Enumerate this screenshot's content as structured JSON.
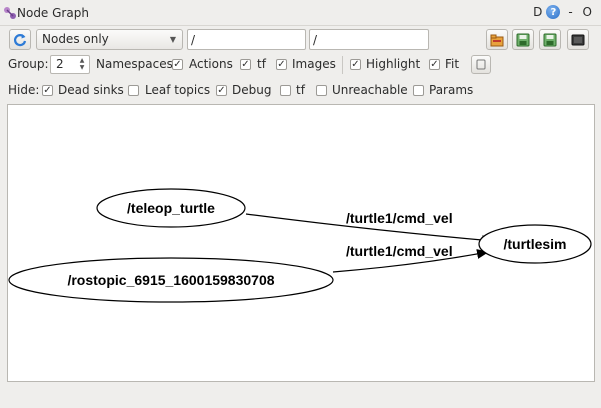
{
  "window": {
    "title": "Node Graph",
    "right_label": "D",
    "help_glyph": "?",
    "controls": "- O"
  },
  "toolbar": {
    "graph_mode": "Nodes only",
    "graph_mode_options": [
      "Nodes only"
    ],
    "filter_nodes": "/",
    "filter_topics": "/",
    "icons": [
      "refresh-icon",
      "load-dot-icon",
      "save-dot-icon",
      "save-svg-icon",
      "save-image-icon"
    ]
  },
  "options": {
    "group_label": "Group:",
    "group_value": "2",
    "namespaces": {
      "label": "Namespaces",
      "checked": true
    },
    "actions": {
      "label": "Actions",
      "checked": true
    },
    "tf": {
      "label": "tf",
      "checked": true
    },
    "images": {
      "label": "Images",
      "checked": true
    },
    "highlight": {
      "label": "Highlight",
      "checked": true
    },
    "fit": {
      "label": "Fit",
      "checked": true
    },
    "fit_icon": "fit-view-icon"
  },
  "hide": {
    "label": "Hide:",
    "dead_sinks": {
      "label": "Dead sinks",
      "checked": true
    },
    "leaf_topics": {
      "label": "Leaf topics",
      "checked": false
    },
    "debug": {
      "label": "Debug",
      "checked": true
    },
    "tf": {
      "label": "tf",
      "checked": false
    },
    "unreachable": {
      "label": "Unreachable",
      "checked": false
    },
    "params": {
      "label": "Params",
      "checked": false
    }
  },
  "check_glyph": "✓",
  "graph": {
    "nodes": [
      {
        "id": "teleop",
        "label": "/teleop_turtle"
      },
      {
        "id": "rostopic",
        "label": "/rostopic_6915_1600159830708"
      },
      {
        "id": "turtlesim",
        "label": "/turtlesim"
      }
    ],
    "edges": [
      {
        "from": "teleop",
        "to": "turtlesim",
        "label": "/turtle1/cmd_vel"
      },
      {
        "from": "rostopic",
        "to": "turtlesim",
        "label": "/turtle1/cmd_vel"
      }
    ]
  }
}
